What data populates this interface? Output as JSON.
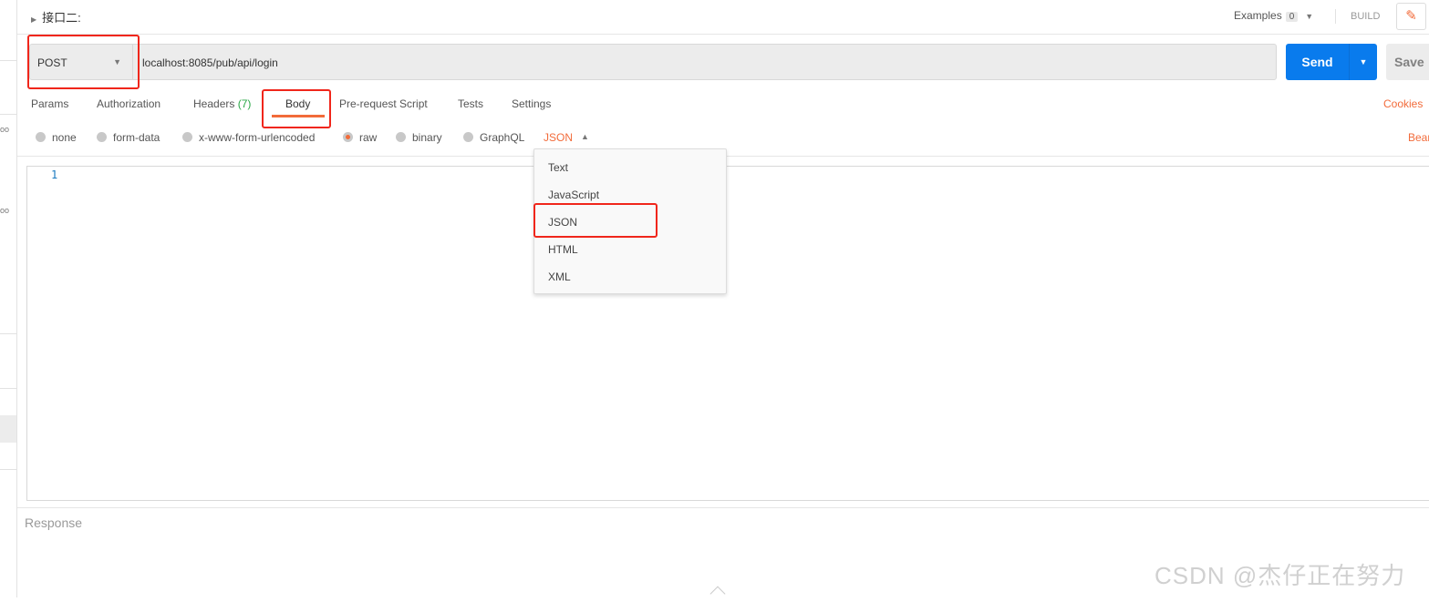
{
  "sidebar": {
    "dots": "oo"
  },
  "header": {
    "title": "接口二:",
    "examples_label": "Examples",
    "examples_count": "0",
    "build_label": "BUILD",
    "edit_icon": "pencil-icon"
  },
  "request": {
    "method": "POST",
    "url": "localhost:8085/pub/api/login",
    "send_label": "Send",
    "save_label": "Save"
  },
  "tabs": [
    {
      "label": "Params"
    },
    {
      "label": "Authorization"
    },
    {
      "label": "Headers",
      "count": "(7)"
    },
    {
      "label": "Body",
      "active": true
    },
    {
      "label": "Pre-request Script"
    },
    {
      "label": "Tests"
    },
    {
      "label": "Settings"
    }
  ],
  "cookies_label": "Cookies",
  "beautify_label": "Bear",
  "body_types": [
    {
      "label": "none"
    },
    {
      "label": "form-data"
    },
    {
      "label": "x-www-form-urlencoded"
    },
    {
      "label": "raw",
      "selected": true
    },
    {
      "label": "binary"
    },
    {
      "label": "GraphQL"
    }
  ],
  "raw_format": {
    "selected": "JSON",
    "options": [
      "Text",
      "JavaScript",
      "JSON",
      "HTML",
      "XML"
    ]
  },
  "editor": {
    "line_numbers": [
      "1"
    ]
  },
  "response": {
    "label": "Response"
  },
  "watermark": "CSDN @杰仔正在努力",
  "colors": {
    "accent": "#f26b3a",
    "send": "#097bed",
    "highlight": "#f0261b"
  }
}
